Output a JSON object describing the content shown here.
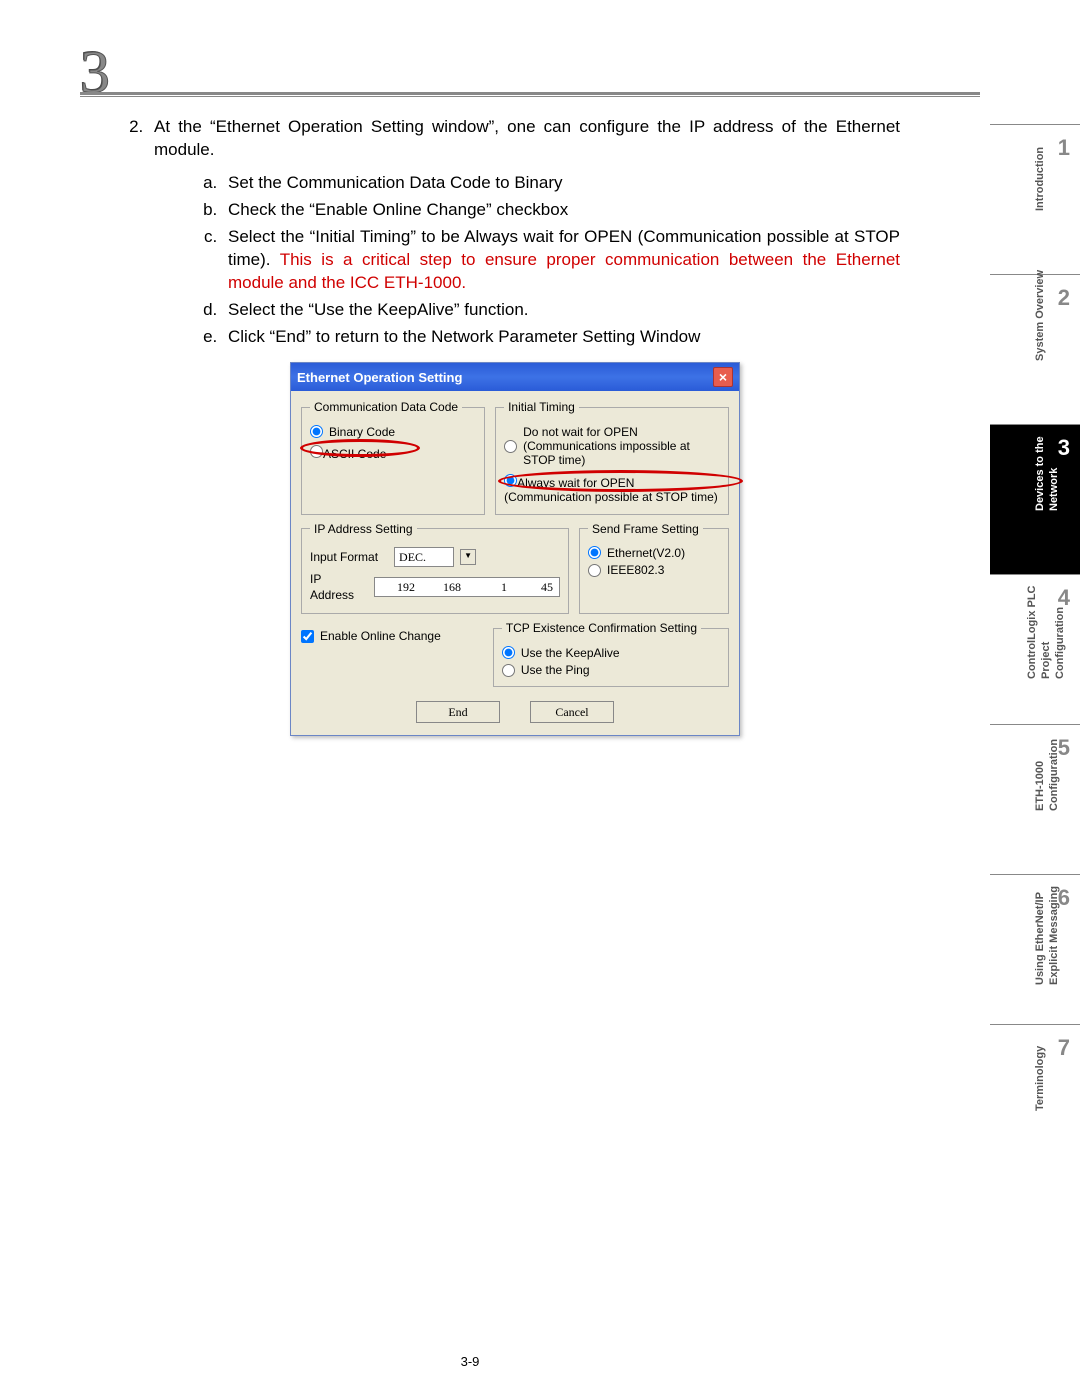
{
  "chapter": "3",
  "pageNumber": "3-9",
  "list": {
    "main": "At the “Ethernet Operation Setting window”, one can configure the IP address of the Ethernet module.",
    "a": "Set the Communication Data Code to Binary",
    "b": "Check the “Enable Online Change” checkbox",
    "c_black": "Select the “Initial Timing” to be Always wait for OPEN (Communication possible at STOP time). ",
    "c_red": "This is a critical step to ensure proper communication between the Ethernet module and the ICC ETH-1000.",
    "d": "Select the “Use the KeepAlive” function.",
    "e": "Click “End” to return to the Network Parameter Setting Window"
  },
  "dialog": {
    "title": "Ethernet Operation Setting",
    "commCode": {
      "legend": "Communication Data Code",
      "binary": "Binary Code",
      "ascii": "ASCII Code"
    },
    "initTiming": {
      "legend": "Initial Timing",
      "opt1": "Do not wait for OPEN (Communications impossible at STOP time)",
      "opt2": "Always wait for OPEN (Communication possible at STOP time)"
    },
    "ipSetting": {
      "legend": "IP Address Setting",
      "inputFormat": "Input Format",
      "format": "DEC.",
      "ipLabel": "IP Address",
      "ip": [
        "192",
        "168",
        "1",
        "45"
      ]
    },
    "sendFrame": {
      "legend": "Send Frame Setting",
      "eth": "Ethernet(V2.0)",
      "ieee": "IEEE802.3"
    },
    "enableOnline": "Enable Online Change",
    "tcpExist": {
      "legend": "TCP Existence Confirmation Setting",
      "keepalive": "Use the KeepAlive",
      "ping": "Use the Ping"
    },
    "end": "End",
    "cancel": "Cancel"
  },
  "tabs": [
    {
      "num": "1",
      "l1": "Introduction",
      "l2": ""
    },
    {
      "num": "2",
      "l1": "System Overview",
      "l2": ""
    },
    {
      "num": "3",
      "l1": "Devices to the",
      "l2": "Network"
    },
    {
      "num": "4",
      "l1": "ControlLogix PLC",
      "l2": "Project",
      "l3": "Configuration"
    },
    {
      "num": "5",
      "l1": "ETH-1000",
      "l2": "Configuration"
    },
    {
      "num": "6",
      "l1": "Using EtherNet/IP",
      "l2": "Explicit Messaging"
    },
    {
      "num": "7",
      "l1": "Terminology",
      "l2": ""
    }
  ]
}
